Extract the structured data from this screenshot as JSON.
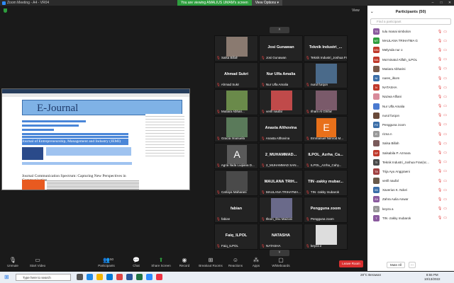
{
  "window": {
    "title": "Zoom Meeting - A4 - VR04",
    "min": "–",
    "max": "□",
    "close": "✕"
  },
  "banner": {
    "viewing": "You are viewing AMALIUS UMAM's screen",
    "view_options": "View Options ▾"
  },
  "view_label": "View",
  "shared": {
    "header": "E-Journal",
    "journal1": "Journal of Entrepreneurship, Management and Industry (JEMI)",
    "journal2": "Journal Communication Spectrum: Capturing New Perspectives in Communication"
  },
  "tiles": [
    {
      "name": "",
      "label": "Salsa Billah"
    },
    {
      "name": "Josi Gunawan",
      "label": "Josi Gunawan"
    },
    {
      "name": "Teknik Industri_...",
      "label": "Teknik Industri_Joshua Fra..."
    },
    {
      "name": "Ahmad Sukri",
      "label": "Ahmad Sukri"
    },
    {
      "name": "Nur Ulfa Amalia",
      "label": "Nur Ulfa Amalia"
    },
    {
      "name": "",
      "label": "nurul furqon"
    },
    {
      "name": "",
      "label": "Mutiara Abhari..."
    },
    {
      "name": "",
      "label": "verill naufal"
    },
    {
      "name": "",
      "label": "Ilham Al Ghifari"
    },
    {
      "name": "",
      "label": "Gracia Imanuela"
    },
    {
      "name": "Anasta Althovina",
      "label": "Anasta Althovina"
    },
    {
      "name": "E",
      "label": "Emmanuel Nimrod M..."
    },
    {
      "name": "A",
      "label": "Agria Ilada Luqiana D..."
    },
    {
      "name": "2_MUHAMMAD...",
      "label": "2_MUHAMMAD SAN..."
    },
    {
      "name": "ILPOL_Azrha_Ca...",
      "label": "ILPOL_Azrha_Cahy..."
    },
    {
      "name": "",
      "label": "Cahaya Maharani"
    },
    {
      "name": "MAULANA TRIH...",
      "label": "MAULANA TRIHATMA..."
    },
    {
      "name": "TIN -zakky mubar...",
      "label": "TIN -zakky mubarok"
    },
    {
      "name": "fabian",
      "label": "fabian"
    },
    {
      "name": "",
      "label": "Ilkom_Ilnu Maizani"
    },
    {
      "name": "Pengguna zoom",
      "label": "Pengguna zoom"
    },
    {
      "name": "Faiq_ILPOL",
      "label": "Faiq_ILPOL"
    },
    {
      "name": "NATASHA",
      "label": "NATASHA"
    },
    {
      "name": "",
      "label": "keyza a"
    }
  ],
  "participants": {
    "title": "Participants (50)",
    "search_placeholder": "Find a participant",
    "list": [
      {
        "initials": "TS",
        "name": "tulu manai simbolon",
        "color": "#8a5a9e"
      },
      {
        "initials": "MT",
        "name": "MAULANA TRIHATMA G",
        "color": "#2e9e3e"
      },
      {
        "initials": "MN",
        "name": "Melynda nur o",
        "color": "#c0392b"
      },
      {
        "initials": "MA",
        "name": "Mu'minatul Alifah_ILPOL",
        "color": "#c0392b"
      },
      {
        "initials": "",
        "name": "Mutiara Abharini",
        "color": "#7a5a4a"
      },
      {
        "initials": "NI",
        "name": "nares_ilkom",
        "color": "#3b6ea8"
      },
      {
        "initials": "N",
        "name": "NATASHA",
        "color": "#c0392b"
      },
      {
        "initials": "",
        "name": "Nazwa Alfiani",
        "color": "#d88a9a"
      },
      {
        "initials": "",
        "name": "Nur Ulfa Amalia",
        "color": "#4a7ad0"
      },
      {
        "initials": "",
        "name": "nurul furqon",
        "color": "#6a4a3a"
      },
      {
        "initials": "PZ",
        "name": "Pengguna zoom",
        "color": "#3b6ea8"
      },
      {
        "initials": "R",
        "name": "rizna n",
        "color": "#999999"
      },
      {
        "initials": "",
        "name": "Salsa Billah",
        "color": "#7a5a5a"
      },
      {
        "initials": "SP",
        "name": "Salsabila P. Azmara",
        "color": "#c0392b"
      },
      {
        "initials": "TI",
        "name": "Teknik Industri_Joshua Fran(sc...",
        "color": "#4a4a4a"
      },
      {
        "initials": "TA",
        "name": "Trija Ayu Anggraeni",
        "color": "#a04040"
      },
      {
        "initials": "",
        "name": "verill naufal",
        "color": "#6a5a4a"
      },
      {
        "initials": "XK",
        "name": "Xaverius K. Ndori",
        "color": "#3b6ea8"
      },
      {
        "initials": "ZA",
        "name": "Zahra Aulia Anwar",
        "color": "#8a5a9e"
      },
      {
        "initials": "K",
        "name": "keyza a",
        "color": "#999999"
      },
      {
        "initials": "T",
        "name": "TIN -zakky mubarok",
        "color": "#8a5a9e"
      }
    ],
    "mute_all": "Mute All",
    "more": "..."
  },
  "toolbar": {
    "unmute": "Unmute",
    "start_video": "Start Video",
    "participants": "Participants",
    "participants_count": "50",
    "chat": "Chat",
    "share_screen": "Share Screen",
    "record": "Record",
    "breakout": "Breakout Rooms",
    "reactions": "Reactions",
    "apps": "Apps",
    "whiteboards": "Whiteboards",
    "leave": "Leave Room"
  },
  "taskbar": {
    "search": "Type here to search",
    "weather": "28°C Berawan",
    "time": "8:55 PM",
    "date": "10/13/2022"
  }
}
